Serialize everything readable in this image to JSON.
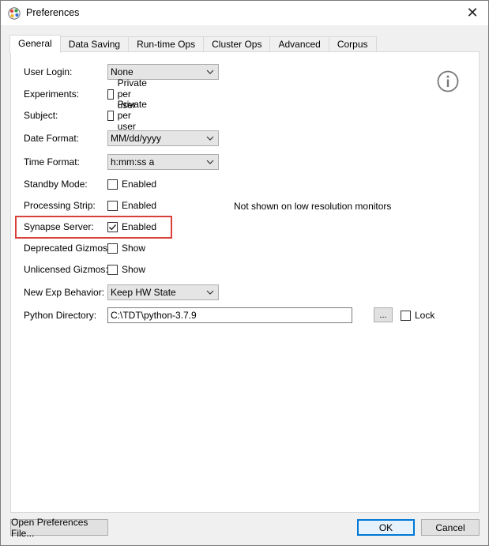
{
  "window": {
    "title": "Preferences",
    "close_symbol": "✕",
    "icon": "app-palette-icon"
  },
  "tabs": [
    {
      "label": "General",
      "active": true
    },
    {
      "label": "Data Saving",
      "active": false
    },
    {
      "label": "Run-time Ops",
      "active": false
    },
    {
      "label": "Cluster Ops",
      "active": false
    },
    {
      "label": "Advanced",
      "active": false
    },
    {
      "label": "Corpus",
      "active": false
    }
  ],
  "general": {
    "user_login": {
      "label": "User Login:",
      "value": "None"
    },
    "experiments": {
      "label": "Experiments:",
      "option": "Private per user",
      "checked": false
    },
    "subject": {
      "label": "Subject:",
      "option": "Private per user",
      "checked": false
    },
    "date_format": {
      "label": "Date Format:",
      "value": "MM/dd/yyyy"
    },
    "time_format": {
      "label": "Time Format:",
      "value": "h:mm:ss a"
    },
    "standby_mode": {
      "label": "Standby Mode:",
      "option": "Enabled",
      "checked": false
    },
    "processing_strip": {
      "label": "Processing Strip:",
      "option": "Enabled",
      "checked": false,
      "note": "Not shown on low resolution monitors"
    },
    "synapse_server": {
      "label": "Synapse Server:",
      "option": "Enabled",
      "checked": true
    },
    "deprecated_gizmos": {
      "label": "Deprecated Gizmos:",
      "option": "Show",
      "checked": false
    },
    "unlicensed_gizmos": {
      "label": "Unlicensed Gizmos:",
      "option": "Show",
      "checked": false
    },
    "new_exp_behavior": {
      "label": "New Exp Behavior:",
      "value": "Keep HW State"
    },
    "python_directory": {
      "label": "Python Directory:",
      "value": "C:\\TDT\\python-3.7.9",
      "browse_label": "...",
      "lock_label": "Lock",
      "lock_checked": false
    }
  },
  "footer": {
    "open_file_label": "Open Preferences File...",
    "ok_label": "OK",
    "cancel_label": "Cancel"
  },
  "colors": {
    "highlight": "#d9403a",
    "default_button_border": "#0078d7"
  }
}
